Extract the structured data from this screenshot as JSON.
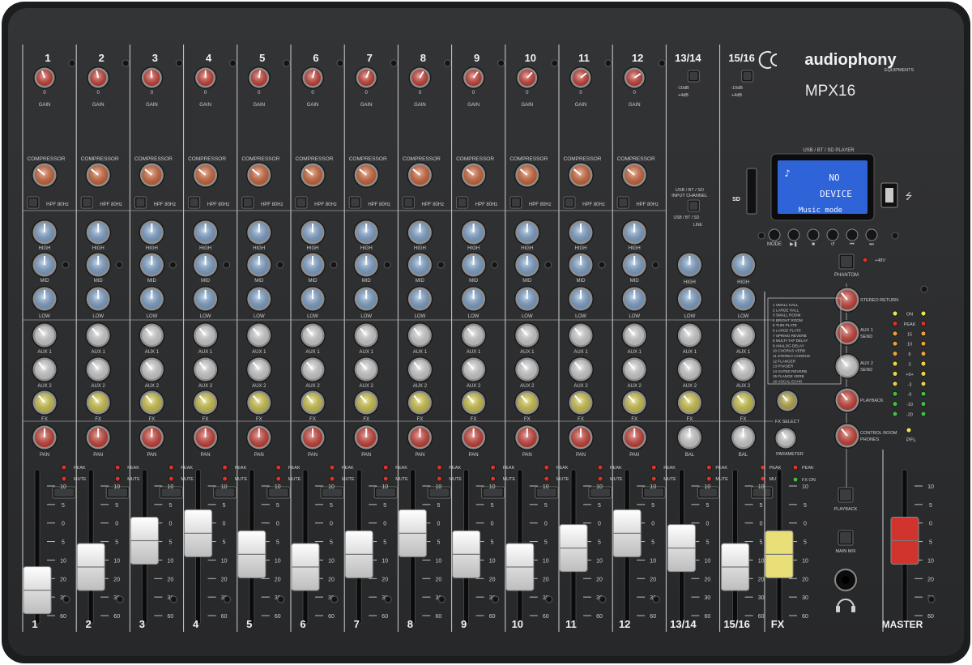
{
  "brand": {
    "logo_text": "audiophony",
    "logo_sub": "EQUIPMENTS",
    "model": "MPX16"
  },
  "channels": [
    {
      "label": "1",
      "fader": 0.08,
      "gain_color": "#e0453a"
    },
    {
      "label": "2",
      "fader": 0.3,
      "gain_color": "#e0453a"
    },
    {
      "label": "3",
      "fader": 0.55,
      "gain_color": "#e0453a"
    },
    {
      "label": "4",
      "fader": 0.62,
      "gain_color": "#e0453a"
    },
    {
      "label": "5",
      "fader": 0.42,
      "gain_color": "#e0453a"
    },
    {
      "label": "6",
      "fader": 0.3,
      "gain_color": "#e0453a"
    },
    {
      "label": "7",
      "fader": 0.42,
      "gain_color": "#e0453a"
    },
    {
      "label": "8",
      "fader": 0.62,
      "gain_color": "#e0453a"
    },
    {
      "label": "9",
      "fader": 0.42,
      "gain_color": "#e0453a"
    },
    {
      "label": "10",
      "fader": 0.3,
      "gain_color": "#e0453a"
    },
    {
      "label": "11",
      "fader": 0.48,
      "gain_color": "#e0453a"
    },
    {
      "label": "12",
      "fader": 0.62,
      "gain_color": "#e0453a"
    }
  ],
  "stereo_channels": [
    {
      "label": "13/14",
      "fader": 0.48
    },
    {
      "label": "15/16",
      "fader": 0.3
    }
  ],
  "fx_channel": {
    "label": "FX",
    "fader": 0.42
  },
  "master": {
    "label": "MASTER",
    "fader": 0.55
  },
  "labels": {
    "gain": "GAIN",
    "compressor": "COMPRESSOR",
    "hpf": "HPF 80Hz",
    "high": "HIGH",
    "mid": "MID",
    "low": "LOW",
    "aux1": "AUX 1",
    "aux2": "AUX 2",
    "fx": "FX",
    "pan": "PAN",
    "bal": "BAL",
    "peak": "PEAK",
    "mute": "MUTE",
    "fx_on": "FX ON",
    "pfl": "PFL",
    "playback": "PLAYBACK",
    "main_mix": "MAIN MIX",
    "phantom": "PHANTOM",
    "plus48v": "+48V",
    "stereo_return": "STEREO RETURN",
    "aux1_send": "AUX 1 SEND",
    "aux2_send": "AUX 2 SEND",
    "playback_knob": "PLAYBACK",
    "control_room": "CONTROL ROOM PHONES",
    "fx_select": "FX SELECT",
    "parameter": "PARAMETER",
    "usb_input": "USB / BT / SD INPUT CHANNEL",
    "player_title": "USB / BT / SD  PLAYER",
    "mode": "MODE",
    "stereo_pad": "-10dB",
    "stereo_pad2": "+4dB"
  },
  "player": {
    "line1": "NO",
    "line2": "DEVICE",
    "line3": "Music mode"
  },
  "fx_list": [
    "1  SMALL HALL",
    "2  LARGE HALL",
    "3  SMALL ROOM",
    "4  BRIGHT ROOM",
    "5  THIN PLATE",
    "6  LARGE PLATE",
    "7  SPRING REVERB",
    "8  MULTI-TAP DELAY",
    "9  ANALOG DELAY",
    "10 CHORUS VERB",
    "11 STEREO CHORUS",
    "12 FLANGER",
    "13 PHASER",
    "14 GATED REVERB",
    "15 FLANGE VERB",
    "16 VOCAL ECHO"
  ],
  "meter_scale": [
    "ON",
    "PEAK",
    "15",
    "10",
    "6",
    "3",
    "+0+",
    "-3",
    "-6",
    "-10",
    "-20"
  ],
  "fader_scale": [
    "10",
    "5",
    "0",
    "5",
    "10",
    "20",
    "30",
    "60"
  ],
  "colors": {
    "panel": "#2e2f31",
    "gain_knob": "#e0453a",
    "comp_knob": "#e8713e",
    "eq_knob": "#8fb8e6",
    "aux_knob": "#ececec",
    "fx_knob": "#e9de52",
    "pan_knob": "#e0453a",
    "lcd": "#2f63d8"
  }
}
